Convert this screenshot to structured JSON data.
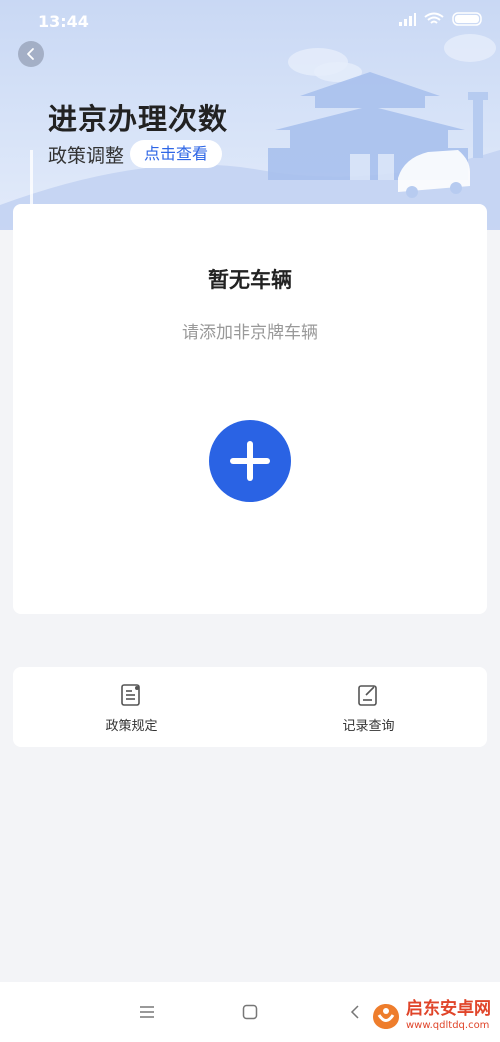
{
  "status_bar": {
    "time": "13:44",
    "icons": [
      "signal-icon",
      "wifi-icon",
      "battery-icon"
    ]
  },
  "header": {
    "title": "进京办理次数",
    "subtitle_label": "政策调整",
    "policy_link_label": "点击查看"
  },
  "empty_state": {
    "title": "暂无车辆",
    "hint": "请添加非京牌车辆",
    "add_icon": "plus-icon"
  },
  "shortcuts": [
    {
      "label": "政策规定",
      "icon": "document-icon"
    },
    {
      "label": "记录查询",
      "icon": "edit-record-icon"
    }
  ],
  "nav_bar": {
    "items": [
      "menu-icon",
      "home-icon",
      "back-icon"
    ]
  },
  "watermark": {
    "name": "启东安卓网",
    "url": "www.qdltdq.com"
  },
  "colors": {
    "accent": "#2a63e4",
    "header_bg": "#d7e3f8",
    "page_bg": "#f3f4f7",
    "watermark": "#e0452a"
  }
}
